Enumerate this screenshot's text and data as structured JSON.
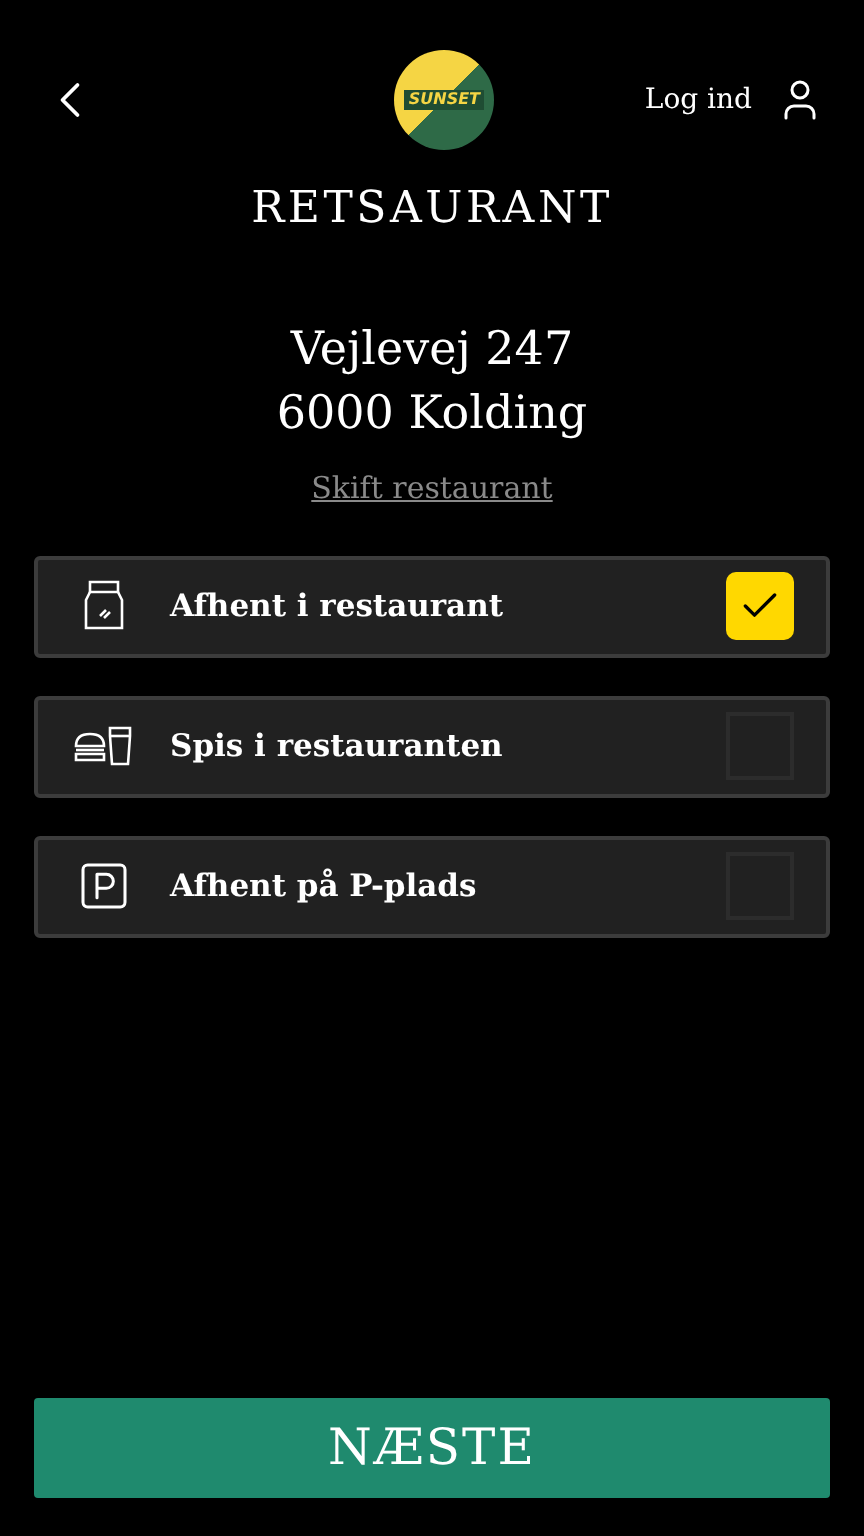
{
  "header": {
    "logo_text": "SUNSET",
    "login": "Log ind"
  },
  "title": "RETSAURANT",
  "address": {
    "street": "Vejlevej 247",
    "city": "6000 Kolding",
    "change_link": "Skift restaurant"
  },
  "options": [
    {
      "kind": "bag",
      "label": "Afhent i restaurant",
      "checked": true
    },
    {
      "kind": "dine",
      "label": "Spis i restauranten",
      "checked": false
    },
    {
      "kind": "parking",
      "label": "Afhent på P-plads",
      "checked": false
    }
  ],
  "next_button": "NÆSTE"
}
